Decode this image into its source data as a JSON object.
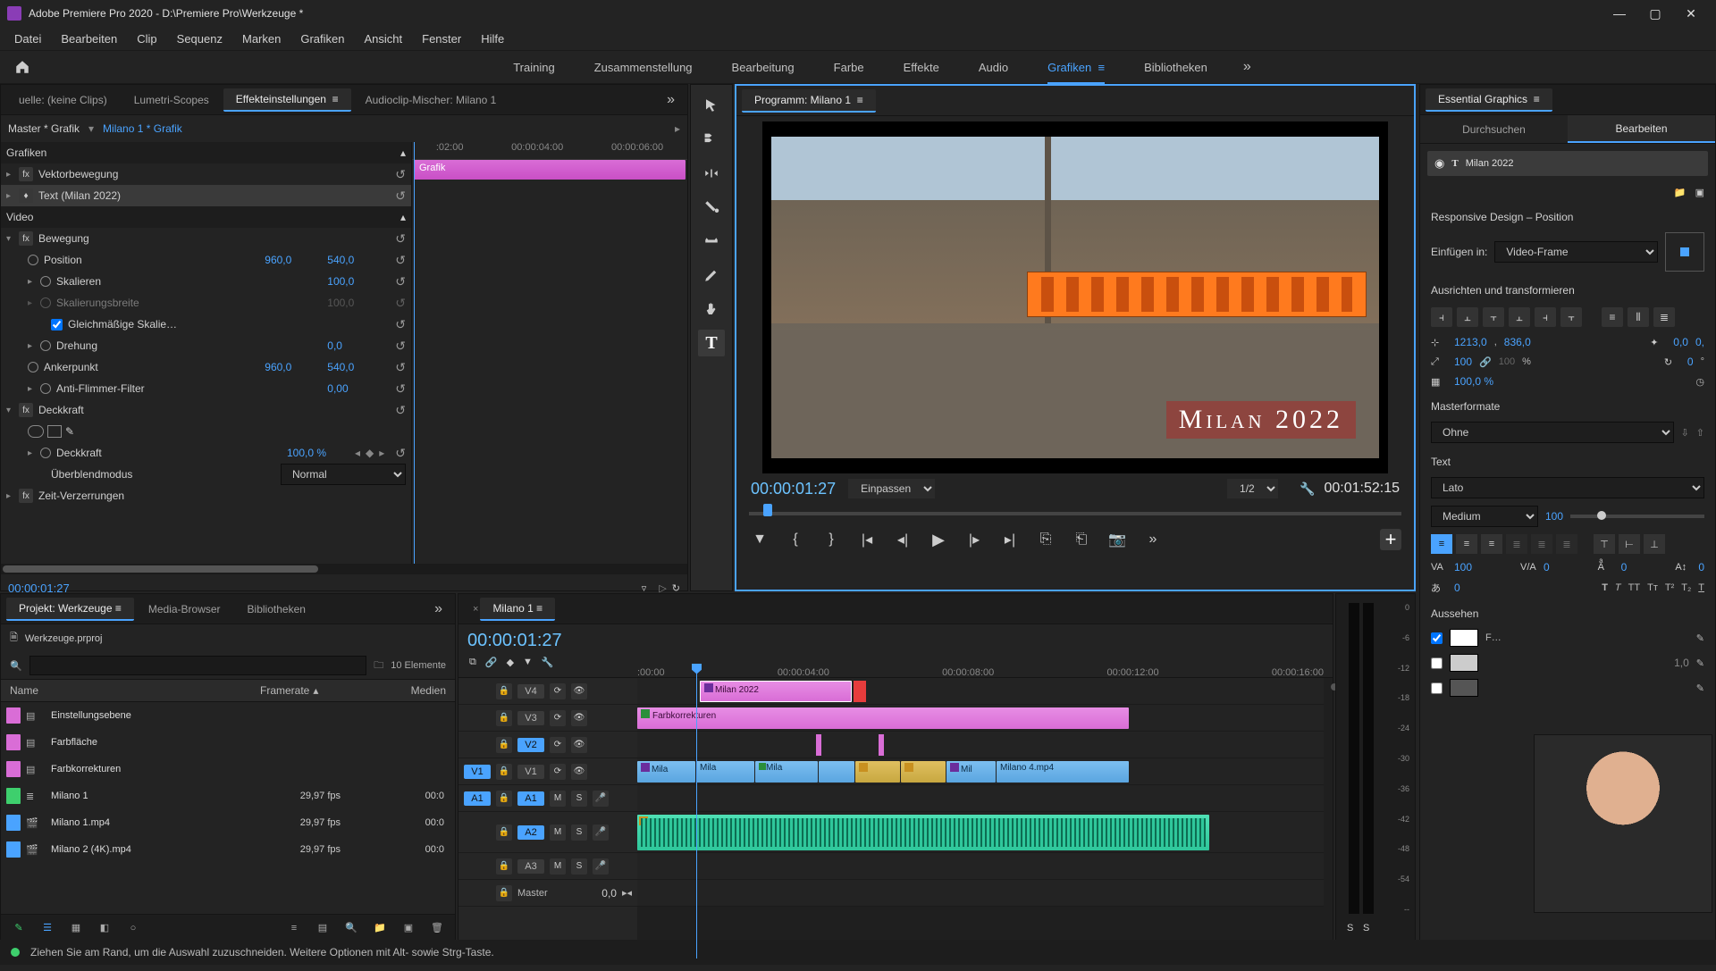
{
  "window": {
    "title": "Adobe Premiere Pro 2020 - D:\\Premiere Pro\\Werkzeuge *"
  },
  "menu": [
    "Datei",
    "Bearbeiten",
    "Clip",
    "Sequenz",
    "Marken",
    "Grafiken",
    "Ansicht",
    "Fenster",
    "Hilfe"
  ],
  "workspaces": {
    "items": [
      "Training",
      "Zusammenstellung",
      "Bearbeitung",
      "Farbe",
      "Effekte",
      "Audio",
      "Grafiken",
      "Bibliotheken"
    ],
    "active": "Grafiken"
  },
  "source_tabs": {
    "items": [
      "uelle: (keine Clips)",
      "Lumetri-Scopes",
      "Effekteinstellungen",
      "Audioclip-Mischer: Milano 1"
    ],
    "active": "Effekteinstellungen"
  },
  "effect_controls": {
    "master": "Master * Grafik",
    "sequence": "Milano 1 * Grafik",
    "ruler": [
      ":02:00",
      "00:00:04:00",
      "00:00:06:00"
    ],
    "clip_label": "Grafik",
    "graphics_header": "Grafiken",
    "vector_motion": "Vektorbewegung",
    "text_layer": "Text (Milan 2022)",
    "video_header": "Video",
    "motion": "Bewegung",
    "position_label": "Position",
    "position_x": "960,0",
    "position_y": "540,0",
    "scale_label": "Skalieren",
    "scale_val": "100,0",
    "scale_w_label": "Skalierungsbreite",
    "scale_w_val": "100,0",
    "uniform_label": "Gleichmäßige Skalie…",
    "rotation_label": "Drehung",
    "rotation_val": "0,0",
    "anchor_label": "Ankerpunkt",
    "anchor_x": "960,0",
    "anchor_y": "540,0",
    "flicker_label": "Anti-Flimmer-Filter",
    "flicker_val": "0,00",
    "opacity_header": "Deckkraft",
    "opacity_label": "Deckkraft",
    "opacity_val": "100,0 %",
    "blend_label": "Überblendmodus",
    "blend_val": "Normal",
    "time_remap": "Zeit-Verzerrungen",
    "timecode": "00:00:01:27"
  },
  "program": {
    "tab": "Programm: Milano 1",
    "overlay_text": "Milan 2022",
    "timecode_current": "00:00:01:27",
    "fit": "Einpassen",
    "zoom": "1/2",
    "timecode_duration": "00:01:52:15"
  },
  "essential_graphics": {
    "panel_title": "Essential Graphics",
    "tabs": [
      "Durchsuchen",
      "Bearbeiten"
    ],
    "active_tab": "Bearbeiten",
    "layer_name": "Milan 2022",
    "responsive_title": "Responsive Design – Position",
    "pin_label": "Einfügen in:",
    "pin_value": "Video-Frame",
    "align_title": "Ausrichten und transformieren",
    "pos_x": "1213,0",
    "pos_y": "836,0",
    "anchor_x": "0,0",
    "anchor_y": "0,",
    "scale": "100",
    "scale_locked": "100",
    "percent": "%",
    "rot": "0",
    "rot_unit": " °",
    "opacity": "100,0 %",
    "master_styles": "Masterformate",
    "master_style_val": "Ohne",
    "text_title": "Text",
    "font": "Lato",
    "weight": "Medium",
    "size": "100",
    "tracking": "100",
    "kerning": "0",
    "baseline": "0",
    "leading": "0",
    "tsume": "0",
    "appearance": "Aussehen",
    "fill_label": "F…",
    "stroke_val": "1,0"
  },
  "project": {
    "tabs": [
      "Projekt: Werkzeuge",
      "Media-Browser",
      "Bibliotheken"
    ],
    "filename": "Werkzeuge.prproj",
    "count": "10 Elemente",
    "columns": [
      "Name",
      "Framerate",
      "Medien"
    ],
    "items": [
      {
        "chip": "pink",
        "name": "Einstellungsebene",
        "fr": "",
        "md": ""
      },
      {
        "chip": "pink",
        "name": "Farbfläche",
        "fr": "",
        "md": ""
      },
      {
        "chip": "pink",
        "name": "Farbkorrekturen",
        "fr": "",
        "md": ""
      },
      {
        "chip": "green",
        "name": "Milano 1",
        "fr": "29,97 fps",
        "md": "00:0"
      },
      {
        "chip": "blue",
        "name": "Milano 1.mp4",
        "fr": "29,97 fps",
        "md": "00:0"
      },
      {
        "chip": "blue",
        "name": "Milano 2 (4K).mp4",
        "fr": "29,97 fps",
        "md": "00:0"
      }
    ]
  },
  "timeline": {
    "tab": "Milano 1",
    "timecode": "00:00:01:27",
    "ruler": [
      ":00:00",
      "00:00:04:00",
      "00:00:08:00",
      "00:00:12:00",
      "00:00:16:00"
    ],
    "tracks": {
      "v4": "V4",
      "v3": "V3",
      "v2": "V2",
      "v1": "V1",
      "a1": "A1",
      "a2": "A2",
      "a3": "A3",
      "master": "Master",
      "master_val": "0,0",
      "v1_patch": "V1",
      "a1_patch": "A1"
    },
    "clips": {
      "v4": "Milan 2022",
      "v3": "Farbkorrekturen",
      "v1": [
        "Mila",
        "Mila",
        "Mila",
        "",
        "",
        "",
        "Mil",
        "Milano 4.mp4"
      ]
    },
    "mute": "M",
    "solo": "S"
  },
  "meters": {
    "scale": [
      "0",
      "-6",
      "-12",
      "-18",
      "-24",
      "-30",
      "-36",
      "-42",
      "-48",
      "-54",
      "--"
    ],
    "solo": "S"
  },
  "status": {
    "text": "Ziehen Sie am Rand, um die Auswahl zuzuschneiden. Weitere Optionen mit Alt- sowie Strg-Taste."
  }
}
